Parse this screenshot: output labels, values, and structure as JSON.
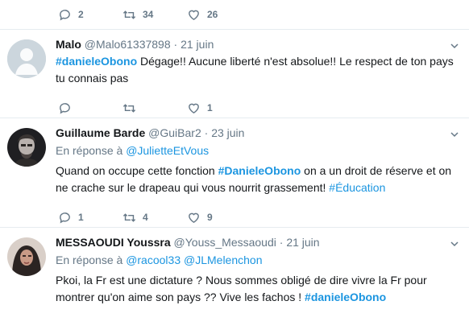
{
  "top_actions": {
    "replies": "2",
    "retweets": "34",
    "likes": "26"
  },
  "tweets": [
    {
      "name": "Malo",
      "handle": "@Malo61337898",
      "dot": "·",
      "date": "21 juin",
      "text_parts": [
        "#danieleObono",
        " Dégage!! Aucune liberté n'est absolue!! Le respect de ton pays tu connais pas"
      ],
      "replies": "",
      "retweets": "",
      "likes": "1"
    },
    {
      "name": "Guillaume Barde",
      "handle": "@GuiBar2",
      "dot": "·",
      "date": "23 juin",
      "reply_prefix": "En réponse à",
      "reply_to": "@JulietteEtVous",
      "text_parts": [
        "Quand on occupe cette fonction ",
        "#DanieleObono",
        " on a un droit de réserve et on ne crache sur le drapeau qui vous nourrit grassement! ",
        "#Éducation"
      ],
      "replies": "1",
      "retweets": "4",
      "likes": "9"
    },
    {
      "name": "MESSAOUDI Youssra",
      "handle": "@Youss_Messaoudi",
      "dot": "·",
      "date": "21 juin",
      "reply_prefix": "En réponse à",
      "reply_to": "@racool33",
      "reply_to_2": "@JLMelenchon",
      "text_parts": [
        "Pkoi, la Fr est une dictature ? Nous sommes obligé de dire vivre la Fr pour montrer qu'on aime son pays ?? Vive les fachos ! ",
        "#danieleObono"
      ]
    }
  ]
}
